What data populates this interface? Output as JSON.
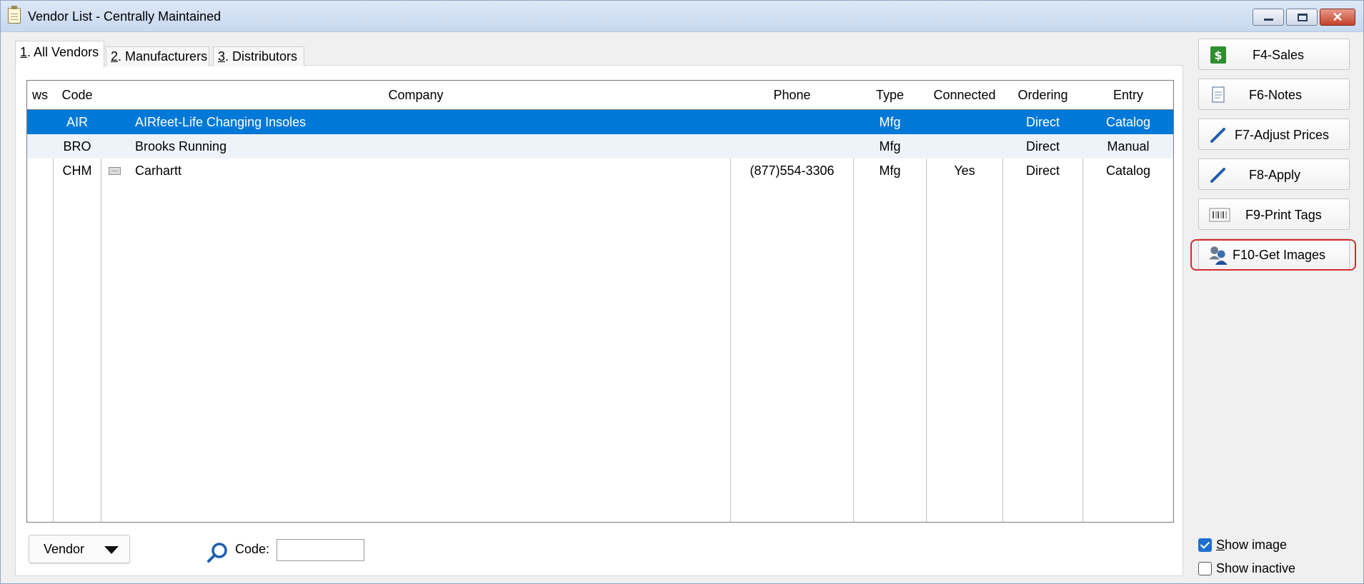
{
  "window": {
    "title": "Vendor List - Centrally Maintained",
    "close_glyph": "✕"
  },
  "tabs": [
    {
      "key": "1",
      "label": ". All Vendors",
      "active": true
    },
    {
      "key": "2",
      "label": ". Manufacturers",
      "active": false
    },
    {
      "key": "3",
      "label": ". Distributors",
      "active": false
    }
  ],
  "table": {
    "columns": [
      "ws",
      "Code",
      "Company",
      "Phone",
      "Type",
      "Connected",
      "Ordering",
      "Entry"
    ],
    "rows": [
      {
        "ws": "",
        "code": "AIR",
        "company": "AIRfeet-Life Changing Insoles",
        "phone": "",
        "type": "Mfg",
        "connected": "",
        "ordering": "Direct",
        "entry": "Catalog",
        "selected": true,
        "has_image": false
      },
      {
        "ws": "",
        "code": "BRO",
        "company": "Brooks Running",
        "phone": "",
        "type": "Mfg",
        "connected": "",
        "ordering": "Direct",
        "entry": "Manual",
        "selected": false,
        "has_image": false
      },
      {
        "ws": "",
        "code": "CHM",
        "company": "Carhartt",
        "phone": "(877)554-3306",
        "type": "Mfg",
        "connected": "Yes",
        "ordering": "Direct",
        "entry": "Catalog",
        "selected": false,
        "has_image": true
      }
    ]
  },
  "footer": {
    "dropdown_value": "Vendor",
    "code_label": "Code:",
    "code_value": ""
  },
  "side_buttons": [
    {
      "label": "F4-Sales",
      "icon": "dollar-icon"
    },
    {
      "label": "F6-Notes",
      "icon": "notes-icon"
    },
    {
      "label": "F7-Adjust Prices",
      "icon": "pencil-icon"
    },
    {
      "label": "F8-Apply",
      "icon": "pencil-icon"
    },
    {
      "label": "F9-Print Tags",
      "icon": "barcode-icon"
    },
    {
      "label": "F10-Get Images",
      "icon": "image-person-icon",
      "highlighted": true
    }
  ],
  "options": {
    "show_image": {
      "label_u": "S",
      "label_rest": "how image",
      "checked": true
    },
    "show_inactive": {
      "label": "Show inactive",
      "checked": false
    }
  },
  "colors": {
    "selection": "#0078d7",
    "highlight_ring": "#d62b2b",
    "checkbox_on": "#1f6fd0"
  }
}
